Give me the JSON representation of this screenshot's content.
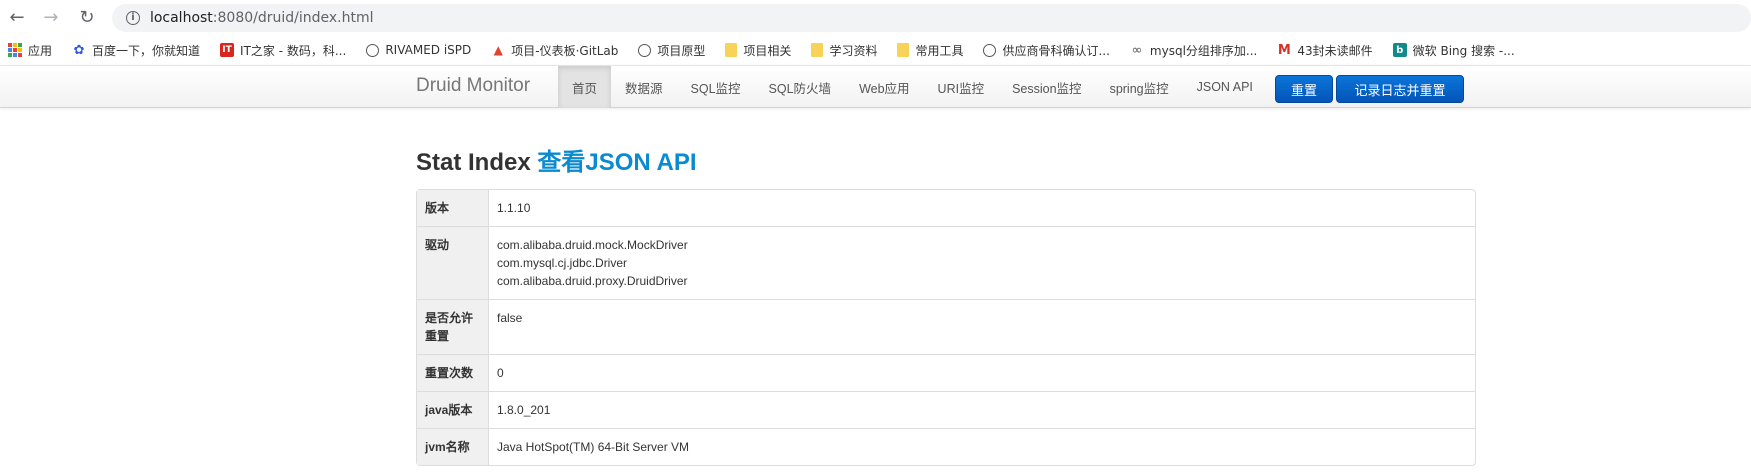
{
  "browser": {
    "url_host": "localhost",
    "url_path": ":8080/druid/index.html"
  },
  "bookmarks": [
    {
      "label": "应用",
      "icon": "apps-icon"
    },
    {
      "label": "百度一下，你就知道",
      "icon": "baidu-paw-icon"
    },
    {
      "label": "IT之家 - 数码，科...",
      "icon": "ithome-icon"
    },
    {
      "label": "RIVAMED iSPD",
      "icon": "globe-icon"
    },
    {
      "label": "项目-仪表板·GitLab",
      "icon": "gitlab-fox-icon"
    },
    {
      "label": "项目原型",
      "icon": "globe-icon"
    },
    {
      "label": "项目相关",
      "icon": "folder-icon"
    },
    {
      "label": "学习资料",
      "icon": "folder-icon"
    },
    {
      "label": "常用工具",
      "icon": "folder-icon"
    },
    {
      "label": "供应商骨科确认订...",
      "icon": "globe-icon"
    },
    {
      "label": "mysql分组排序加...",
      "icon": "mysql-dolphin-icon"
    },
    {
      "label": "43封未读邮件",
      "icon": "gmail-icon"
    },
    {
      "label": "微软 Bing 搜索 -...",
      "icon": "bing-icon"
    }
  ],
  "navbar": {
    "brand": "Druid Monitor",
    "items": [
      "首页",
      "数据源",
      "SQL监控",
      "SQL防火墙",
      "Web应用",
      "URI监控",
      "Session监控",
      "spring监控",
      "JSON API"
    ],
    "active_index": 0,
    "reset_label": "重置",
    "log_reset_label": "记录日志并重置"
  },
  "page": {
    "title": "Stat Index",
    "title_link": "查看JSON API"
  },
  "stats": [
    {
      "key": "版本",
      "values": [
        "1.1.10"
      ]
    },
    {
      "key": "驱动",
      "values": [
        "com.alibaba.druid.mock.MockDriver",
        "com.mysql.cj.jdbc.Driver",
        "com.alibaba.druid.proxy.DruidDriver"
      ]
    },
    {
      "key": "是否允许重置",
      "values": [
        "false"
      ]
    },
    {
      "key": "重置次数",
      "values": [
        "0"
      ]
    },
    {
      "key": "java版本",
      "values": [
        "1.8.0_201"
      ]
    },
    {
      "key": "jvm名称",
      "values": [
        "Java HotSpot(TM) 64-Bit Server VM"
      ]
    }
  ],
  "colors": {
    "primary_button": "#0a64c8",
    "link": "#0a8ad0",
    "key_cell_bg": "#f0f0f0"
  }
}
